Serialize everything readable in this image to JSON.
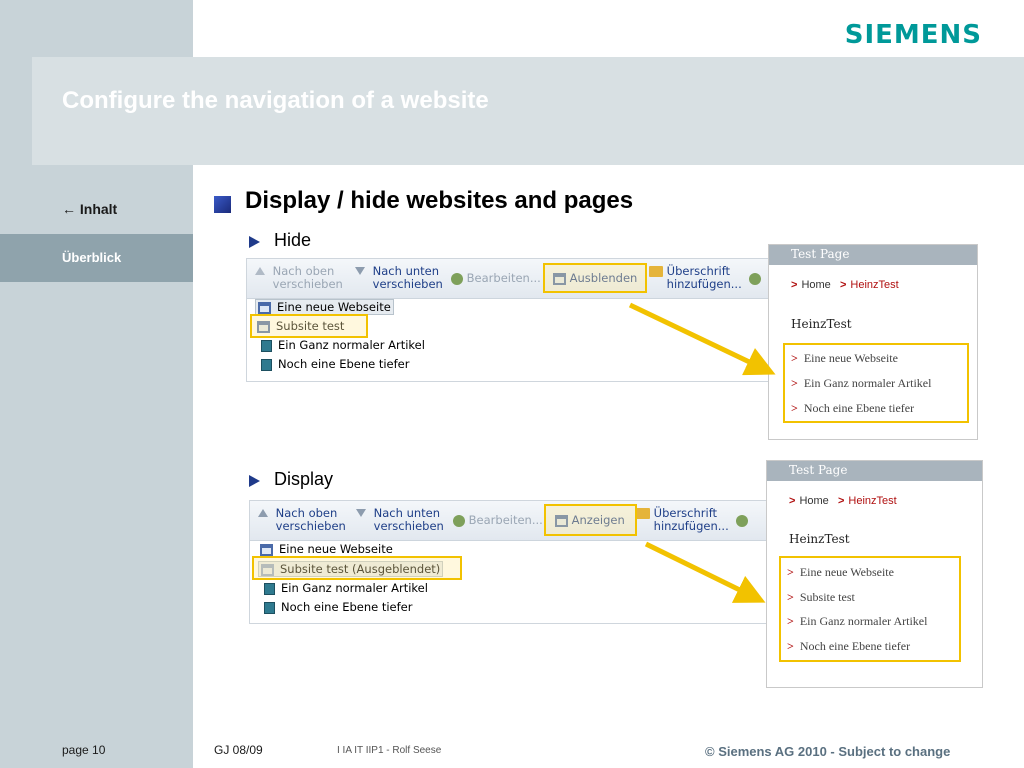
{
  "header": {
    "title": "Configure the navigation of a website",
    "logo": "SIEMENS",
    "logo_color": "#009999"
  },
  "sidebar": {
    "back_label": "← Inhalt",
    "active_label": "Überblick",
    "page_label": "page 10"
  },
  "content": {
    "heading": "Display / hide websites and pages",
    "hide_section": {
      "label": "Hide",
      "toolbar": {
        "move_up": "Nach oben\nverschieben",
        "move_down": "Nach unten\nverschieben",
        "edit": "Bearbeiten...",
        "action": "Ausblenden",
        "add_heading": "Überschrift\nhinzufügen..."
      },
      "tree": [
        "Eine neue Webseite",
        "Subsite test",
        "Ein Ganz normaler Artikel",
        "Noch eine Ebene tiefer"
      ],
      "preview": {
        "header": "Test Page",
        "crumb_home": "Home",
        "crumb_current": "HeinzTest",
        "title": "HeinzTest",
        "items": [
          "Eine neue Webseite",
          "Ein Ganz normaler Artikel",
          "Noch eine Ebene tiefer"
        ]
      }
    },
    "display_section": {
      "label": "Display",
      "toolbar": {
        "move_up": "Nach oben\nverschieben",
        "move_down": "Nach unten\nverschieben",
        "edit": "Bearbeiten...",
        "action": "Anzeigen",
        "add_heading": "Überschrift\nhinzufügen..."
      },
      "tree": [
        "Eine neue Webseite",
        "Subsite test (Ausgeblendet)",
        "Ein Ganz normaler Artikel",
        "Noch eine Ebene tiefer"
      ],
      "preview": {
        "header": "Test Page",
        "crumb_home": "Home",
        "crumb_current": "HeinzTest",
        "title": "HeinzTest",
        "items": [
          "Eine neue Webseite",
          "Subsite test",
          "Ein Ganz normaler Artikel",
          "Noch eine Ebene tiefer"
        ]
      }
    }
  },
  "footer": {
    "date": "GJ 08/09",
    "dept": "I IA IT IIP1 - Rolf Seese",
    "copyright": "© Siemens AG 2010  -  Subject to change"
  },
  "colors": {
    "highlight": "#f2c200",
    "arrow": "#f2c200",
    "sidebar_bg": "#c8d3d8",
    "sidebar_active": "#8fa3ac"
  }
}
